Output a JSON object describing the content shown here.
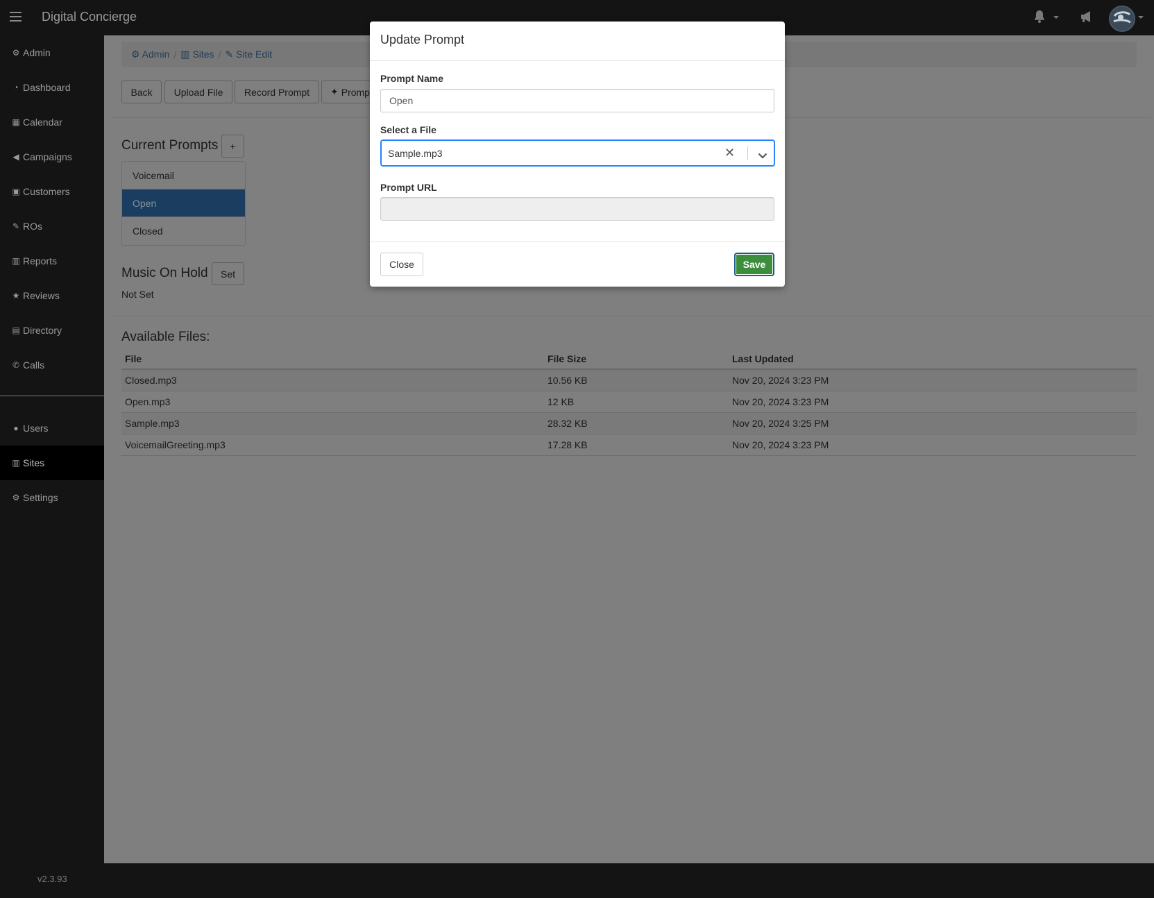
{
  "navbar": {
    "brand": "Digital Concierge",
    "icons": [
      "hamburger-icon",
      "bell-icon",
      "megaphone-icon",
      "avatar"
    ]
  },
  "sidebar": {
    "items": [
      {
        "label": "Admin",
        "icon": "gear-icon"
      },
      {
        "label": "Dashboard",
        "icon": "tachometer-icon"
      },
      {
        "label": "Calendar",
        "icon": "calendar-icon"
      },
      {
        "label": "Campaigns",
        "icon": "megaphone-icon"
      },
      {
        "label": "Customers",
        "icon": "contact-card-icon"
      },
      {
        "label": "ROs",
        "icon": "wrench-icon"
      },
      {
        "label": "Reports",
        "icon": "bar-chart-icon"
      },
      {
        "label": "Reviews",
        "icon": "star-icon"
      },
      {
        "label": "Directory",
        "icon": "book-icon"
      },
      {
        "label": "Calls",
        "icon": "phone-icon"
      }
    ],
    "admin_items": [
      {
        "label": "Users",
        "icon": "users-icon"
      },
      {
        "label": "Sites",
        "icon": "building-icon",
        "active": true
      },
      {
        "label": "Settings",
        "icon": "gear-icon"
      }
    ],
    "version": "v2.3.93"
  },
  "breadcrumb": {
    "items": [
      "Admin",
      "Sites",
      "Site Edit"
    ]
  },
  "toolbar": {
    "back": "Back",
    "upload": "Upload File",
    "record": "Record Prompt",
    "prompt": "Promp"
  },
  "prompts": {
    "title": "Current Prompts",
    "add_label": "+",
    "items": [
      "Voicemail",
      "Open",
      "Closed"
    ],
    "active_index": 1
  },
  "music_on_hold": {
    "title": "Music On Hold",
    "set_label": "Set",
    "value": "Not Set"
  },
  "available_files": {
    "title": "Available Files:",
    "columns": [
      "File",
      "File Size",
      "Last Updated"
    ],
    "rows": [
      [
        "Closed.mp3",
        "10.56 KB",
        "Nov 20, 2024 3:23 PM"
      ],
      [
        "Open.mp3",
        "12 KB",
        "Nov 20, 2024 3:23 PM"
      ],
      [
        "Sample.mp3",
        "28.32 KB",
        "Nov 20, 2024 3:25 PM"
      ],
      [
        "VoicemailGreeting.mp3",
        "17.28 KB",
        "Nov 20, 2024 3:23 PM"
      ]
    ]
  },
  "modal": {
    "title": "Update Prompt",
    "prompt_name_label": "Prompt Name",
    "prompt_name_value": "Open",
    "select_file_label": "Select a File",
    "select_file_value": "Sample.mp3",
    "prompt_url_label": "Prompt URL",
    "prompt_url_value": "",
    "close_label": "Close",
    "save_label": "Save",
    "colors": {
      "save_bg": "#3c8d3c",
      "focus_border": "#2684ff"
    }
  }
}
